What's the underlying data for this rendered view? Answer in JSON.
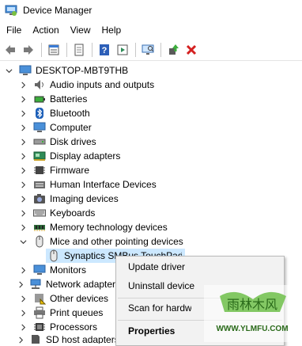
{
  "window": {
    "title": "Device Manager"
  },
  "menu": [
    "File",
    "Action",
    "View",
    "Help"
  ],
  "toolbar": {
    "icons": [
      "back-icon",
      "forward-icon",
      "properties-icon",
      "update-driver-icon",
      "help-icon",
      "run-icon",
      "scan-hardware-icon",
      "enable-device-icon",
      "uninstall-icon"
    ]
  },
  "tree": {
    "root": "DESKTOP-MBT9THB",
    "items": [
      {
        "label": "Audio inputs and outputs",
        "icon": "speaker-icon"
      },
      {
        "label": "Batteries",
        "icon": "battery-icon"
      },
      {
        "label": "Bluetooth",
        "icon": "bluetooth-icon"
      },
      {
        "label": "Computer",
        "icon": "computer-icon"
      },
      {
        "label": "Disk drives",
        "icon": "disk-icon"
      },
      {
        "label": "Display adapters",
        "icon": "display-adapter-icon"
      },
      {
        "label": "Firmware",
        "icon": "firmware-icon"
      },
      {
        "label": "Human Interface Devices",
        "icon": "hid-icon"
      },
      {
        "label": "Imaging devices",
        "icon": "camera-icon"
      },
      {
        "label": "Keyboards",
        "icon": "keyboard-icon"
      },
      {
        "label": "Memory technology devices",
        "icon": "memory-icon"
      },
      {
        "label": "Mice and other pointing devices",
        "icon": "mouse-icon",
        "expanded": true
      },
      {
        "label": "Synaptics SMBus TouchPad",
        "icon": "mouse-icon",
        "child": true,
        "selected": true
      },
      {
        "label": "Monitors",
        "icon": "monitor-icon"
      },
      {
        "label": "Network adapters",
        "icon": "network-icon"
      },
      {
        "label": "Other devices",
        "icon": "other-device-icon"
      },
      {
        "label": "Print queues",
        "icon": "printer-icon"
      },
      {
        "label": "Processors",
        "icon": "processor-icon"
      },
      {
        "label": "SD host adapters",
        "icon": "sd-icon"
      }
    ]
  },
  "context_menu": {
    "items": [
      "Update driver",
      "Uninstall device",
      "Scan for hardware changes",
      "Properties"
    ]
  },
  "watermark": {
    "top": "雨林木风",
    "bottom": "WWW.YLMFU.COM"
  }
}
